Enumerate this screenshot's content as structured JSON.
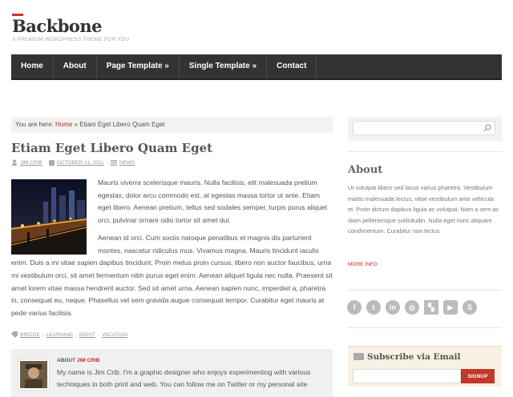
{
  "site": {
    "title": "Backbone",
    "tagline": "A PREMIUM WORDPRESS THEME FOR YOU"
  },
  "nav": [
    "Home",
    "About",
    "Page Template »",
    "Single Template »",
    "Contact"
  ],
  "breadcrumb": {
    "prefix": "You are here:",
    "home": "Home",
    "sep": "»",
    "current": "Etiam Eget Libero Quam Eget"
  },
  "post": {
    "title": "Etiam Eget Libero Quam Eget",
    "author": "JIM CRIB",
    "date": "OCTOBER 21, 2011",
    "category": "NEWS",
    "p1": "Mauris viverra scelerisque mauris. Nulla facilisis, elit malesuada pretium egestas, dolor arcu commodo est, at egestas massa tortor ut ante. Etiam eget libero. Aenean pretium, tellus sed sodales semper, turpis purus aliquet orci, pulvinar ornare odio tortor sit amet dui.",
    "p2": "Aenean id orci. Cum sociis natoque penatibus et magnis dis parturient montes, nascetur ridiculus mus. Vivamus magna. Mauris tincidunt iaculis enim. Duis a mi vitae sapien dapibus tincidunt. Proin metus proin cursus, libero non auctor faucibus, urna mi vestibulum orci, sit amet fermentum nibh purus eget enim. Aenean aliquet ligula nec nulla. Praesent sit amet lorem vitae massa hendrerit auctor. Sed sit amet urna. Aenean sapien nunc, imperdiet a, pharetra in, consequat eu, neque. Phasellus vel sem gravida augue consequat tempor. Curabitur eget mauris at pede varius facilisis.",
    "tags": [
      "BRIDGE",
      "LEARNING",
      "NIGHT",
      "VACATION"
    ]
  },
  "author_box": {
    "label": "ABOUT",
    "name": "JIM CRIB",
    "bio": "My name is Jim Crib. I'm a graphic designer who enjoys experimenting with various techniques in both print and web. You can follow me on Twitter or my personal site"
  },
  "sidebar": {
    "about_title": "About",
    "about_text": "Ut volutpat libero sed lacus varius pharetra. Vestibulum mattis malesuada lectus, vitae vestibulum ante vehicula et. Proin dictum dapibus ligula ac volutpat. Nam a sem ac diam pellentesque sollicitudin. Nulla eget nunc aliquam condimentum. Curabitur non lectus",
    "more_info": "MORE INFO",
    "social": [
      "facebook-icon",
      "twitter-icon",
      "linkedin-icon",
      "dribbble-icon",
      "delicious-icon",
      "youtube-icon",
      "skype-icon"
    ],
    "subscribe_title": "Subscribe via Email",
    "signup": "SIGNUP"
  },
  "colors": {
    "accent": "#c62828",
    "nav_bg": "#333333"
  }
}
